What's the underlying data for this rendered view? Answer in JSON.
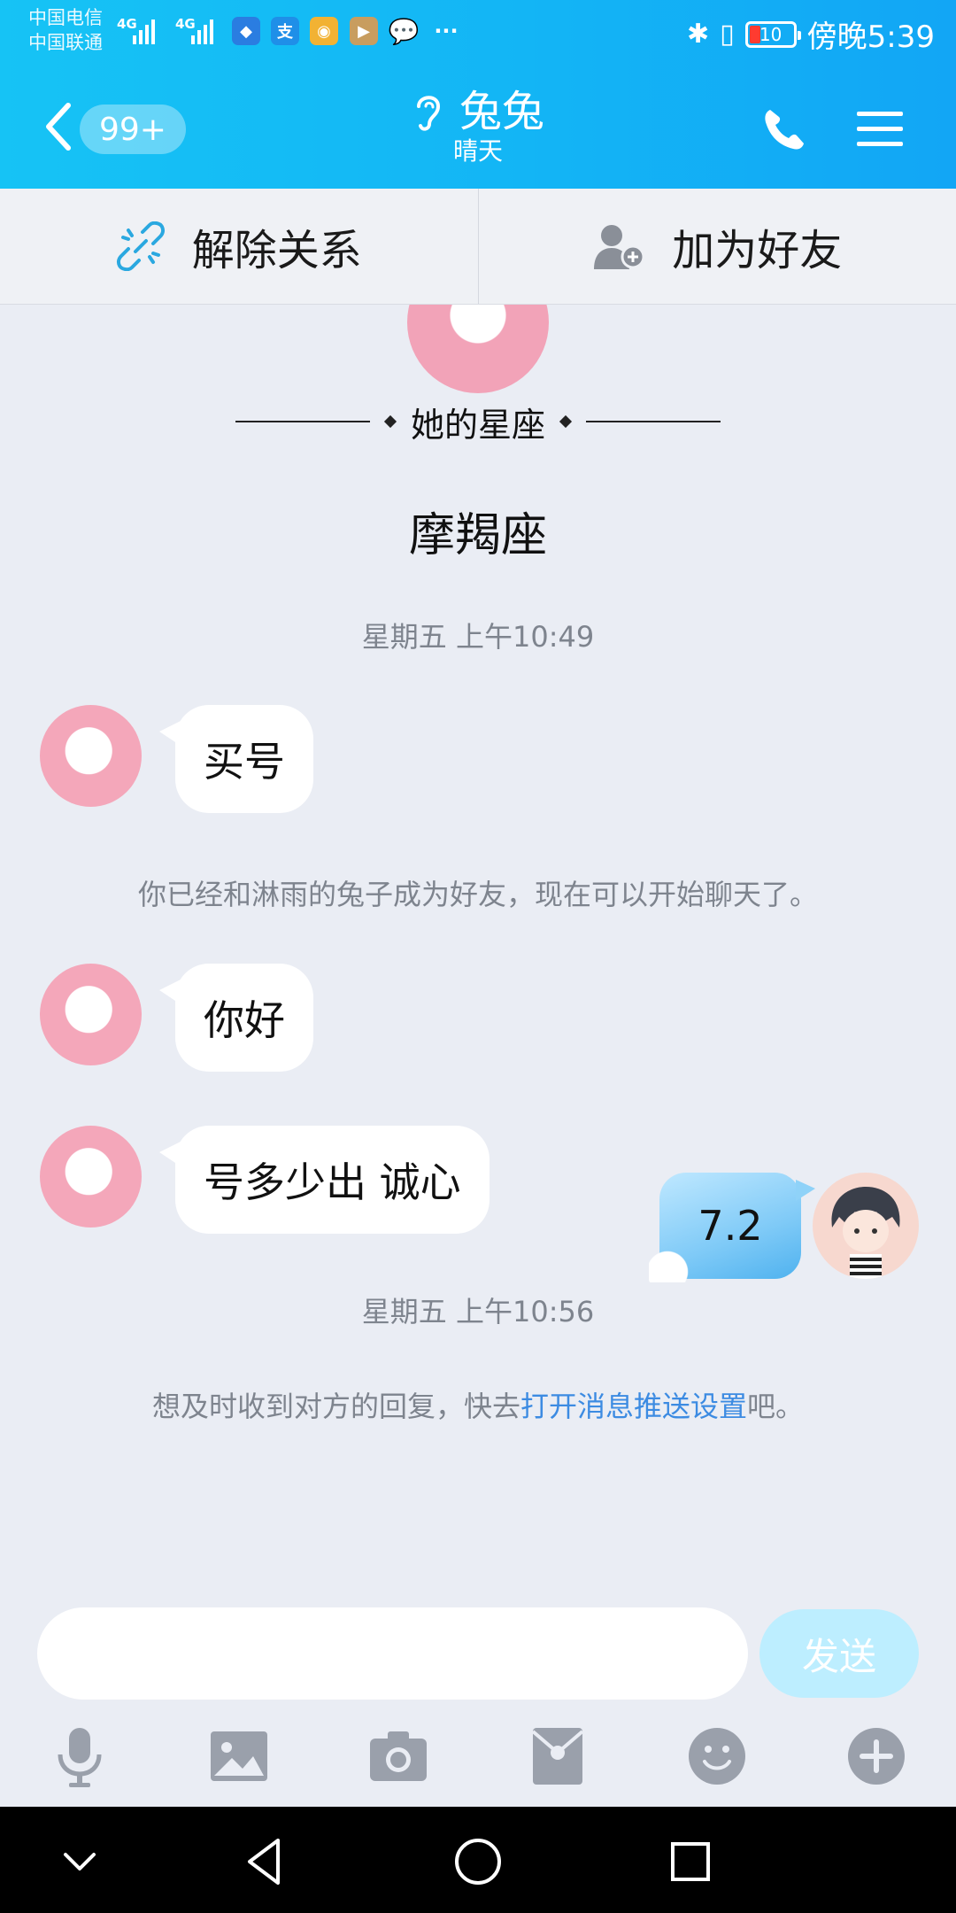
{
  "status_bar": {
    "carrier_1": "中国电信",
    "carrier_2": "中国联通",
    "network_1": "4G",
    "network_2": "4G",
    "battery": "10",
    "time": "傍晚5:39"
  },
  "header": {
    "unread_badge": "99+",
    "title": "兔兔",
    "subtitle": "晴天"
  },
  "relation_bar": {
    "unbind_label": "解除关系",
    "add_friend_label": "加为好友"
  },
  "profile_card": {
    "zodiac_heading": "她的星座",
    "zodiac_value": "摩羯座"
  },
  "messages": {
    "time_1": "星期五 上午10:49",
    "msg_1": "买号",
    "system_1": "你已经和淋雨的兔子成为好友，现在可以开始聊天了。",
    "msg_2": "你好",
    "msg_3": "号多少出 诚心",
    "time_2": "星期五 上午10:56",
    "system_2_prefix": "想及时收到对方的回复，快去",
    "system_2_link": "打开消息推送设置",
    "system_2_suffix": "吧。",
    "my_msg": "7.2"
  },
  "composer": {
    "input_value": "",
    "send_label": "发送"
  },
  "toolbar": {
    "icons": [
      "microphone-icon",
      "image-icon",
      "camera-icon",
      "red-packet-icon",
      "emoji-icon",
      "plus-icon"
    ]
  },
  "colors": {
    "header_gradient_start": "#16c3f5",
    "header_gradient_end": "#12a6f5",
    "chat_background": "#eaedf4",
    "link": "#3c8be2",
    "send_button": "#bdeeff"
  }
}
